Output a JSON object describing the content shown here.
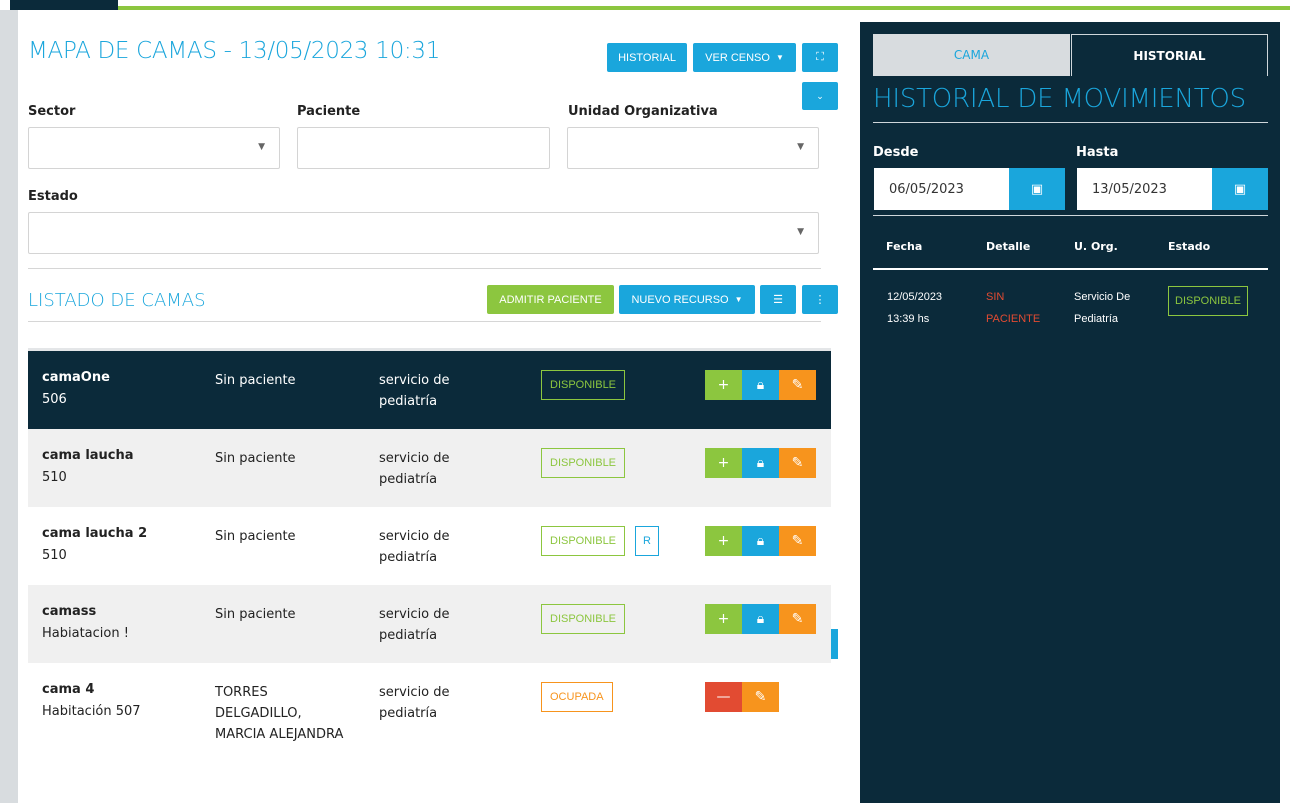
{
  "header": {
    "title": "MAPA DE CAMAS - 13/05/2023 10:31",
    "historial_label": "HISTORIAL",
    "ver_censo_label": "VER CENSO",
    "expand_icon": "expand-icon",
    "collapse_icon": "chevron-down-icon"
  },
  "filters": {
    "sector_label": "Sector",
    "sector_value": "",
    "paciente_label": "Paciente",
    "paciente_value": "",
    "unidad_label": "Unidad Organizativa",
    "unidad_value": "",
    "estado_label": "Estado",
    "estado_value": ""
  },
  "listado": {
    "title": "LISTADO DE CAMAS",
    "admitir_label": "ADMITIR PACIENTE",
    "nuevo_recurso_label": "NUEVO RECURSO",
    "rows": [
      {
        "name": "camaOne",
        "room": "506",
        "patient": "Sin paciente",
        "service": "servicio de pediatría",
        "status": "DISPONIBLE",
        "extra": ""
      },
      {
        "name": "cama laucha",
        "room": "510",
        "patient": "Sin paciente",
        "service": "servicio de pediatría",
        "status": "DISPONIBLE",
        "extra": ""
      },
      {
        "name": "cama laucha 2",
        "room": "510",
        "patient": "Sin paciente",
        "service": "servicio de pediatría",
        "status": "DISPONIBLE",
        "extra": "R"
      },
      {
        "name": "camass",
        "room": "Habiatacion !",
        "patient": "Sin paciente",
        "service": "servicio de pediatría",
        "status": "DISPONIBLE",
        "extra": ""
      },
      {
        "name": "cama 4",
        "room": "Habitación 507",
        "patient": "TORRES DELGADILLO, MARCIA ALEJANDRA",
        "service": "servicio de pediatría",
        "status": "OCUPADA",
        "extra": ""
      }
    ]
  },
  "panel": {
    "tab_cama": "CAMA",
    "tab_historial": "HISTORIAL",
    "title": "HISTORIAL DE MOVIMIENTOS",
    "desde_label": "Desde",
    "desde_value": "06/05/2023",
    "hasta_label": "Hasta",
    "hasta_value": "13/05/2023",
    "columns": [
      "Fecha",
      "Detalle",
      "U. Org.",
      "Estado"
    ],
    "movement": {
      "date": "12/05/2023",
      "time": "13:39 hs",
      "detalle_1": "SIN",
      "detalle_2": "PACIENTE",
      "uorg_1": "Servicio De",
      "uorg_2": "Pediatría",
      "estado": "DISPONIBLE"
    }
  },
  "colors": {
    "accent": "#1aa6dc",
    "green": "#8cc63f",
    "orange": "#f7941d",
    "red": "#e24b32",
    "dark": "#0b2a3a"
  }
}
